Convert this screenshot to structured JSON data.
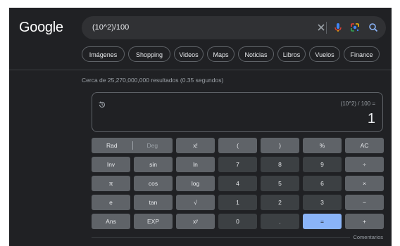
{
  "logo": "Google",
  "search": {
    "query": "(10^2)/100"
  },
  "chips": [
    "Imágenes",
    "Shopping",
    "Videos",
    "Maps",
    "Noticias",
    "Libros",
    "Vuelos",
    "Finance"
  ],
  "stats": "Cerca de 25,270,000,000 resultados (0.35 segundos)",
  "calculator": {
    "expression": "(10^2) / 100 =",
    "result": "1",
    "rad_label": "Rad",
    "deg_label": "Deg",
    "rows": [
      [
        "x!",
        "(",
        ")",
        "%",
        "AC"
      ],
      [
        "Inv",
        "sin",
        "ln",
        "7",
        "8",
        "9",
        "÷"
      ],
      [
        "π",
        "cos",
        "log",
        "4",
        "5",
        "6",
        "×"
      ],
      [
        "e",
        "tan",
        "√",
        "1",
        "2",
        "3",
        "−"
      ],
      [
        "Ans",
        "EXP",
        "xʸ",
        "0",
        ".",
        "=",
        "+"
      ]
    ]
  },
  "feedback": "Comentarios",
  "colors": {
    "background": "#202124",
    "accent": "#8ab4f8",
    "key_fn": "#5f6368",
    "key_num": "#3c4043"
  }
}
